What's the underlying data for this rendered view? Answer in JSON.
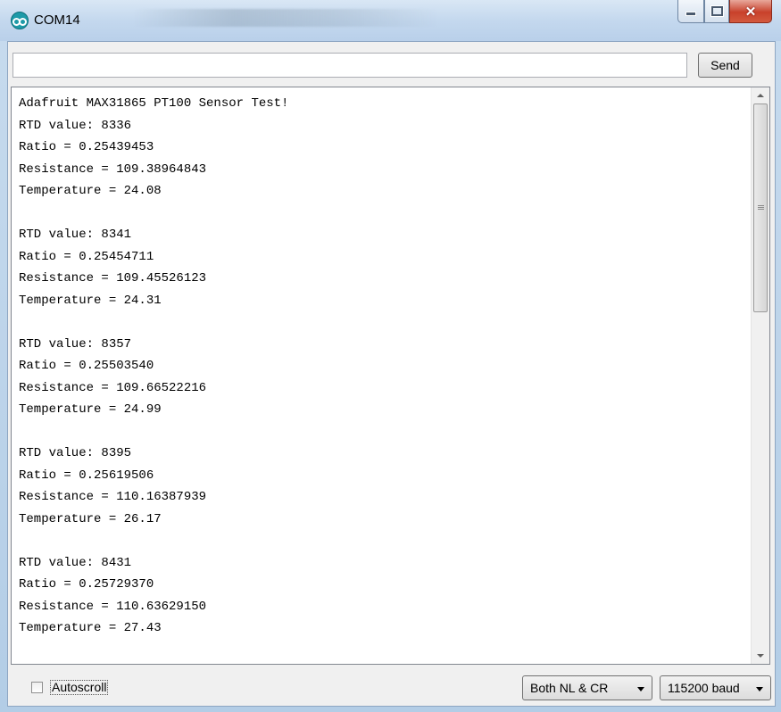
{
  "window": {
    "title": "COM14",
    "icon": "arduino-icon",
    "controls": [
      "minimize-icon",
      "maximize-icon",
      "close-icon"
    ]
  },
  "send_bar": {
    "input_value": "",
    "send_label": "Send"
  },
  "output": {
    "lines": [
      "Adafruit MAX31865 PT100 Sensor Test!",
      "RTD value: 8336",
      "Ratio = 0.25439453",
      "Resistance = 109.38964843",
      "Temperature = 24.08",
      "",
      "RTD value: 8341",
      "Ratio = 0.25454711",
      "Resistance = 109.45526123",
      "Temperature = 24.31",
      "",
      "RTD value: 8357",
      "Ratio = 0.25503540",
      "Resistance = 109.66522216",
      "Temperature = 24.99",
      "",
      "RTD value: 8395",
      "Ratio = 0.25619506",
      "Resistance = 110.16387939",
      "Temperature = 26.17",
      "",
      "RTD value: 8431",
      "Ratio = 0.25729370",
      "Resistance = 110.63629150",
      "Temperature = 27.43"
    ]
  },
  "bottom": {
    "autoscroll_label": "Autoscroll",
    "autoscroll_checked": false,
    "line_ending": "Both NL & CR",
    "baud_rate": "115200 baud"
  }
}
